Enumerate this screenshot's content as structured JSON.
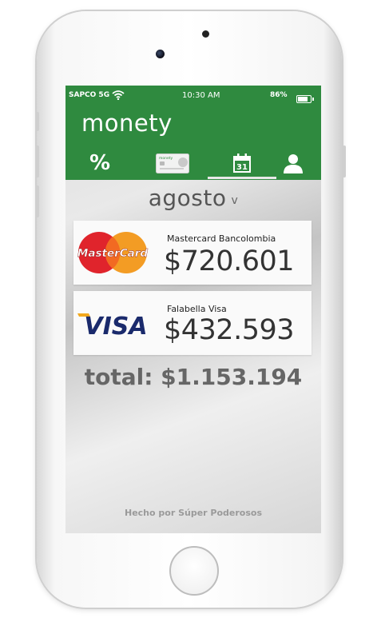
{
  "status_bar": {
    "carrier": "SAPCO 5G",
    "time": "10:30 AM",
    "battery": "86%"
  },
  "app": {
    "name": "monety"
  },
  "tabs": [
    {
      "label": "%",
      "icon": "percent-icon"
    },
    {
      "icon": "card-icon",
      "card_text": "monety"
    },
    {
      "icon": "calendar-icon",
      "day": "31"
    },
    {
      "icon": "user-icon"
    }
  ],
  "month": {
    "label": "agosto",
    "chevron": "v"
  },
  "cards": [
    {
      "name": "Mastercard Bancolombia",
      "amount": "$720.601",
      "logo_text": "MasterCard",
      "brand": "mastercard"
    },
    {
      "name": "Falabella Visa",
      "amount": "$432.593",
      "logo_text": "VISA",
      "brand": "visa"
    }
  ],
  "total": {
    "label": "total: $1.153.194"
  },
  "footer": {
    "text": "Hecho por Súper Poderosos"
  },
  "colors": {
    "header": "#2f8a3f",
    "mastercard_red": "#e0242c",
    "mastercard_orange": "#f39c24",
    "visa_blue": "#1a2a6c",
    "visa_gold": "#f2a81d"
  }
}
